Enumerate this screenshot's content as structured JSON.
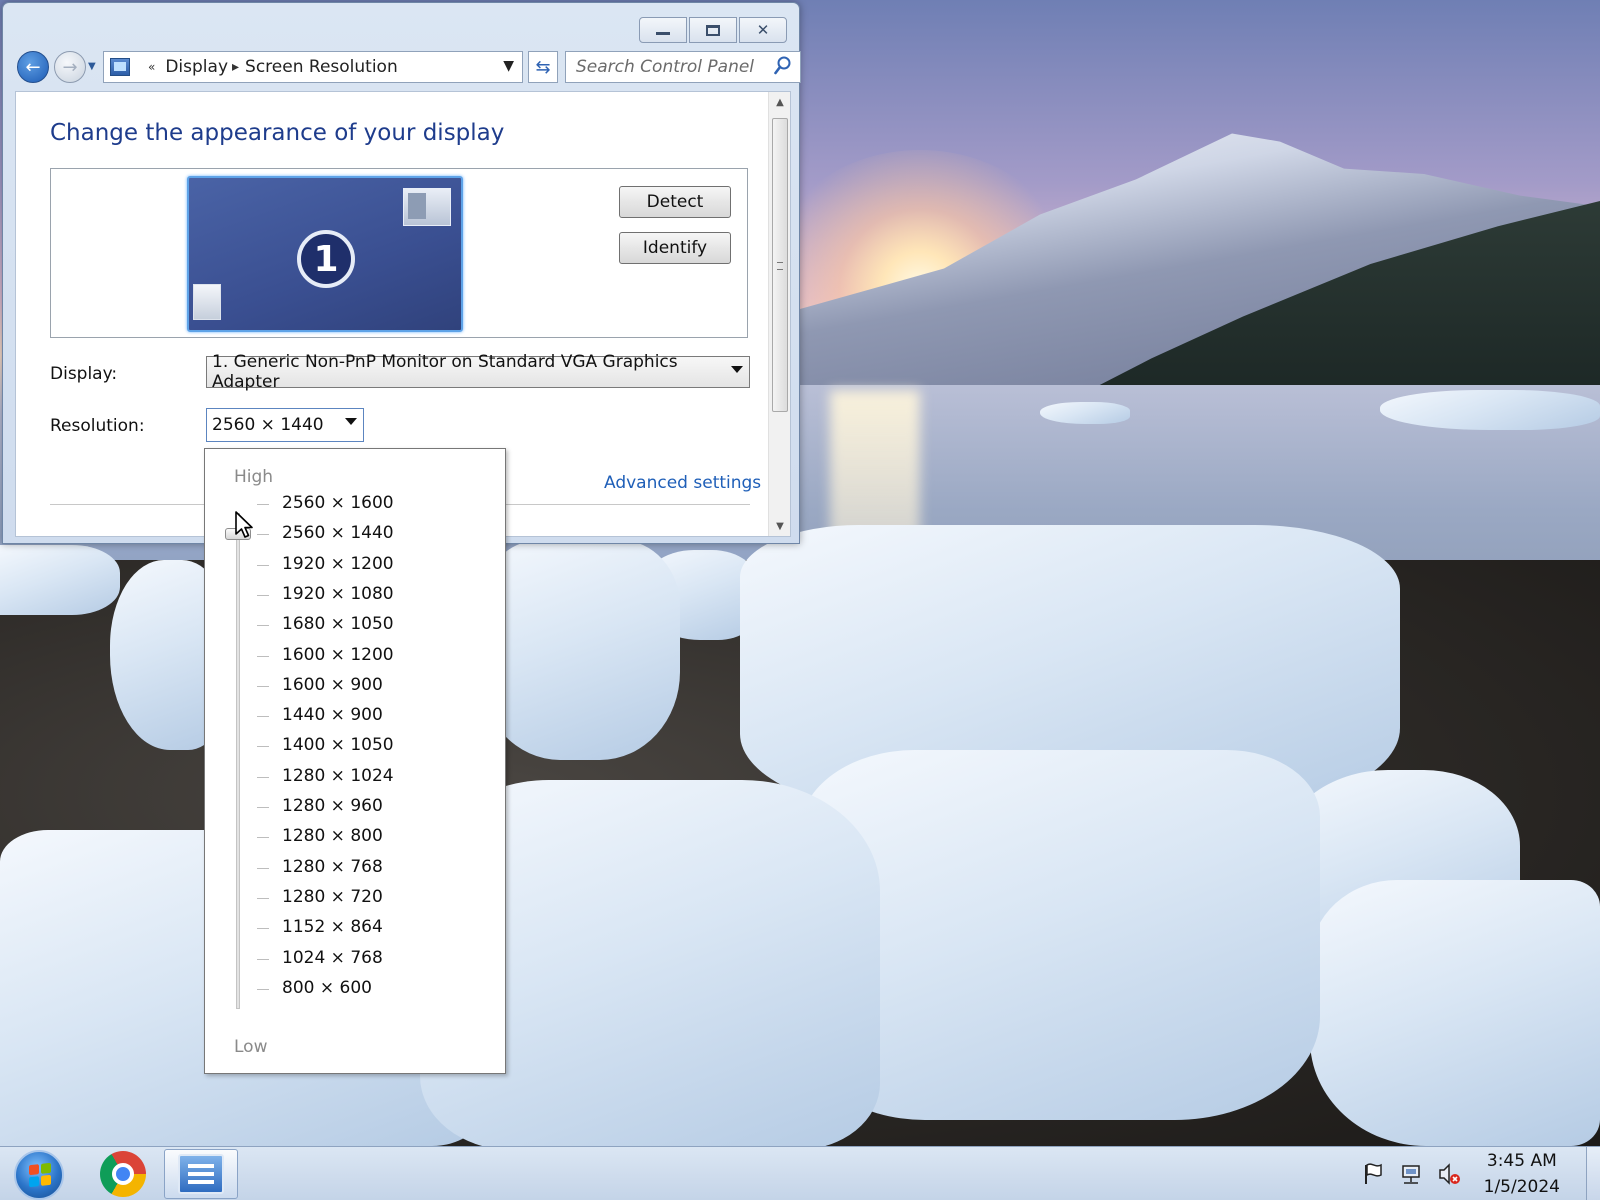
{
  "window": {
    "address": {
      "overflow": "«",
      "crumbs": [
        "Display",
        "Screen Resolution"
      ]
    },
    "search_placeholder": "Search Control Panel",
    "title": "Change the appearance of your display",
    "monitor_number": "1",
    "buttons": {
      "detect": "Detect",
      "identify": "Identify"
    },
    "display_label": "Display:",
    "display_value": "1. Generic Non-PnP Monitor on Standard VGA Graphics Adapter",
    "resolution_label": "Resolution:",
    "resolution_value": "2560 × 1440",
    "advanced_settings": "Advanced settings"
  },
  "resolution_dropdown": {
    "high_label": "High",
    "low_label": "Low",
    "selected_index": 1,
    "options": [
      "2560 × 1600",
      "2560 × 1440",
      "1920 × 1200",
      "1920 × 1080",
      "1680 × 1050",
      "1600 × 1200",
      "1600 × 900",
      "1440 × 900",
      "1400 × 1050",
      "1280 × 1024",
      "1280 × 960",
      "1280 × 800",
      "1280 × 768",
      "1280 × 720",
      "1152 × 864",
      "1024 × 768",
      "800 × 600"
    ]
  },
  "taskbar": {
    "time": "3:45 AM",
    "date": "1/5/2024",
    "pinned": [
      "start-orb",
      "chrome-icon",
      "control-panel-icon"
    ],
    "tray_icons": [
      "action-center-flag-icon",
      "network-icon",
      "volume-muted-icon"
    ]
  },
  "colors": {
    "title_blue": "#1e3c8c",
    "link_blue": "#1f5fb8",
    "monitor_blue": "#3a4f91"
  }
}
